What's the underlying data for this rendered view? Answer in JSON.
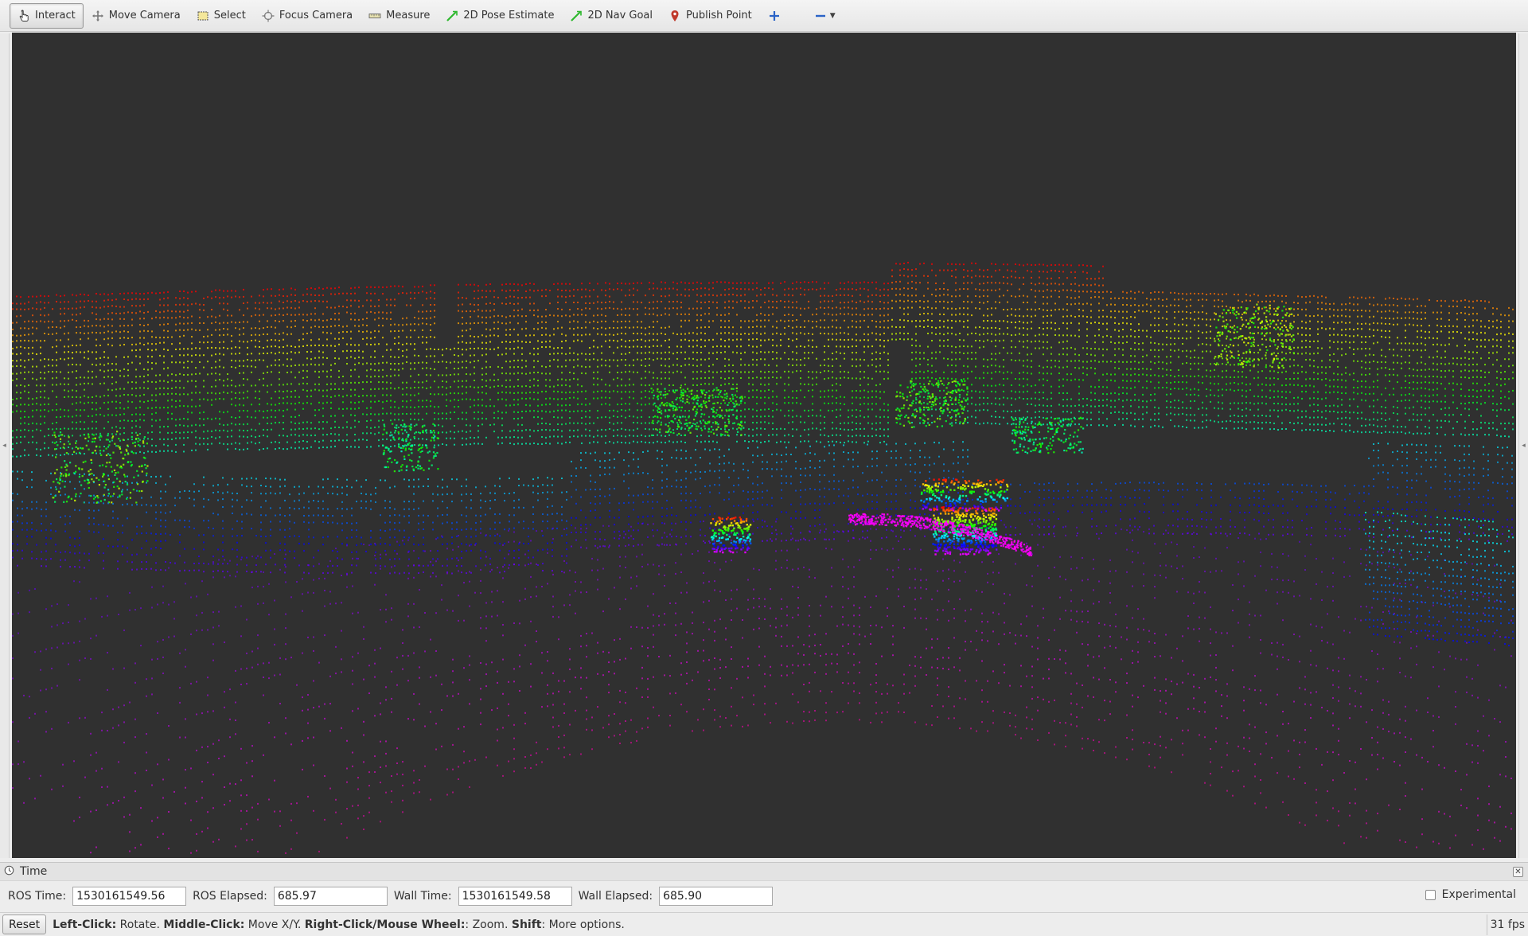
{
  "toolbar": {
    "tools": [
      {
        "id": "interact",
        "label": "Interact",
        "icon": "hand-pointer-icon",
        "active": true
      },
      {
        "id": "move-camera",
        "label": "Move Camera",
        "icon": "move-arrows-icon"
      },
      {
        "id": "select",
        "label": "Select",
        "icon": "select-box-icon"
      },
      {
        "id": "focus-camera",
        "label": "Focus Camera",
        "icon": "crosshair-icon"
      },
      {
        "id": "measure",
        "label": "Measure",
        "icon": "ruler-icon"
      },
      {
        "id": "2d-pose-estimate",
        "label": "2D Pose Estimate",
        "icon": "green-arrow-icon"
      },
      {
        "id": "2d-nav-goal",
        "label": "2D Nav Goal",
        "icon": "green-arrow-icon"
      },
      {
        "id": "publish-point",
        "label": "Publish Point",
        "icon": "map-pin-icon"
      }
    ],
    "add_tool_icon": "plus-icon",
    "remove_tool_icon": "minus-dropdown-icon"
  },
  "time_panel": {
    "title": "Time",
    "title_icon": "clock-icon",
    "ros_time_label": "ROS Time:",
    "ros_time_value": "1530161549.56",
    "ros_elapsed_label": "ROS Elapsed:",
    "ros_elapsed_value": "685.97",
    "wall_time_label": "Wall Time:",
    "wall_time_value": "1530161549.58",
    "wall_elapsed_label": "Wall Elapsed:",
    "wall_elapsed_value": "685.90",
    "experimental_label": "Experimental",
    "experimental_checked": false
  },
  "statusbar": {
    "reset_label": "Reset",
    "hint_parts": [
      {
        "bold": true,
        "text": "Left-Click:"
      },
      {
        "bold": false,
        "text": " Rotate. "
      },
      {
        "bold": true,
        "text": "Middle-Click:"
      },
      {
        "bold": false,
        "text": " Move X/Y. "
      },
      {
        "bold": true,
        "text": "Right-Click/Mouse Wheel:"
      },
      {
        "bold": false,
        "text": ": Zoom. "
      },
      {
        "bold": true,
        "text": "Shift"
      },
      {
        "bold": false,
        "text": ": More options."
      }
    ],
    "fps": "31 fps"
  },
  "viewport": {
    "background": "#303030",
    "content": "lidar point cloud colored by height (red top, green middle, blue/magenta bottom)"
  }
}
